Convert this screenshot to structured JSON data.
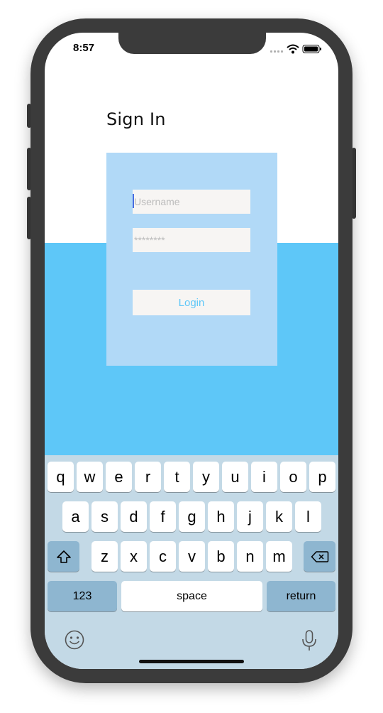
{
  "status_bar": {
    "time": "8:57"
  },
  "page": {
    "title": "Sign In"
  },
  "form": {
    "username_placeholder": "Username",
    "username_value": "",
    "password_placeholder": "********",
    "password_value": "",
    "login_label": "Login"
  },
  "keyboard": {
    "row1": [
      "q",
      "w",
      "e",
      "r",
      "t",
      "y",
      "u",
      "i",
      "o",
      "p"
    ],
    "row2": [
      "a",
      "s",
      "d",
      "f",
      "g",
      "h",
      "j",
      "k",
      "l"
    ],
    "row3": [
      "z",
      "x",
      "c",
      "v",
      "b",
      "n",
      "m"
    ],
    "numbers_label": "123",
    "space_label": "space",
    "return_label": "return",
    "icons": {
      "shift": "shift-icon",
      "delete": "delete-icon",
      "emoji": "emoji-icon",
      "dictation": "microphone-icon"
    }
  },
  "colors": {
    "accent_blue": "#5ec7f8",
    "card_blue": "#b1d9f7",
    "field_bg": "#f7f5f3",
    "keyboard_bg": "#c3d9e6",
    "key_dark": "#8eb6d0"
  }
}
